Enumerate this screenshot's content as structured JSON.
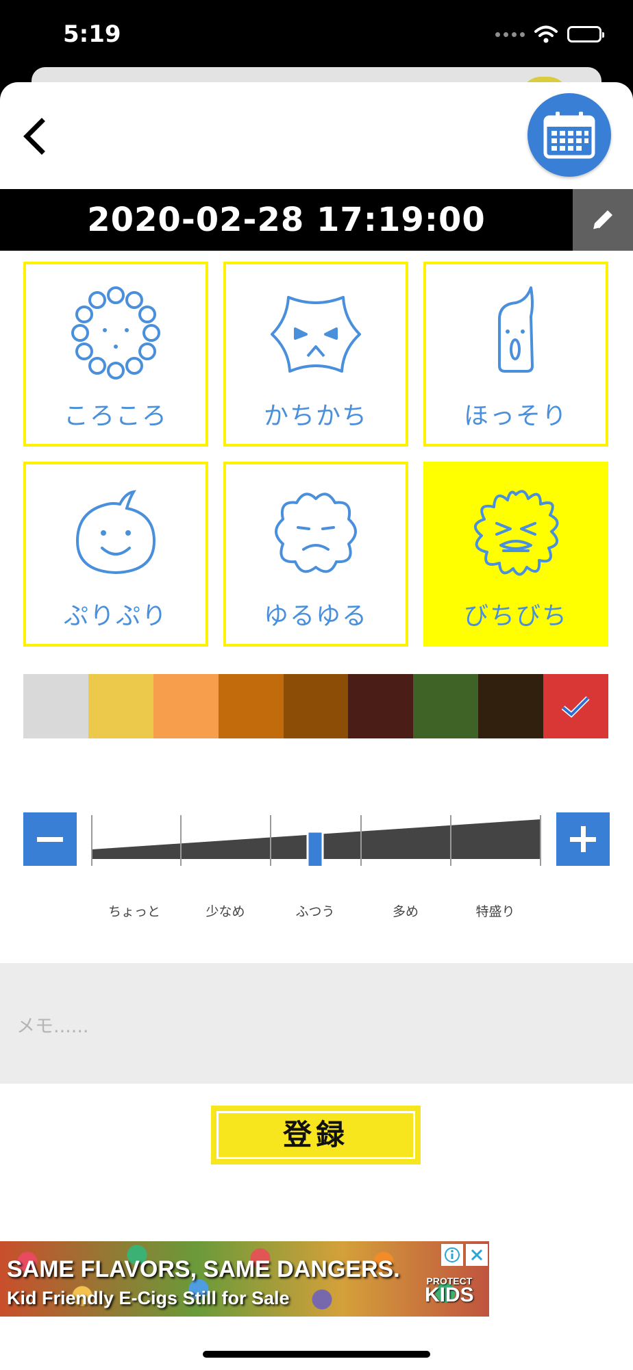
{
  "status_bar": {
    "time": "5:19",
    "icons": [
      "signal-dots-icon",
      "wifi-icon",
      "battery-icon"
    ]
  },
  "header": {
    "back_icon": "chevron-left-icon",
    "calendar_icon": "calendar-icon"
  },
  "datetime": {
    "value": "2020-02-28 17:19:00",
    "edit_icon": "pencil-icon"
  },
  "stool_types": [
    {
      "label": "ころころ",
      "selected": false
    },
    {
      "label": "かちかち",
      "selected": false
    },
    {
      "label": "ほっそり",
      "selected": false
    },
    {
      "label": "ぷりぷり",
      "selected": false
    },
    {
      "label": "ゆるゆる",
      "selected": false
    },
    {
      "label": "びちびち",
      "selected": true
    }
  ],
  "colors": {
    "swatches": [
      "#d9d9d9",
      "#ecc94b",
      "#f79e4c",
      "#c16b0c",
      "#8c4e07",
      "#4a1e16",
      "#3f6227",
      "#30200d",
      "#d93636"
    ],
    "selected_index": 8
  },
  "amount": {
    "labels": [
      "ちょっと",
      "少なめ",
      "ふつう",
      "多め",
      "特盛り"
    ],
    "selected_index": 2
  },
  "memo": {
    "placeholder": "メモ......",
    "value": ""
  },
  "register": {
    "label": "登録"
  },
  "ad": {
    "headline": "SAME FLAVORS, SAME DANGERS.",
    "subline": "Kid Friendly E-Cigs Still for Sale",
    "brand_top": "PROTECT",
    "brand": "KIDS"
  }
}
